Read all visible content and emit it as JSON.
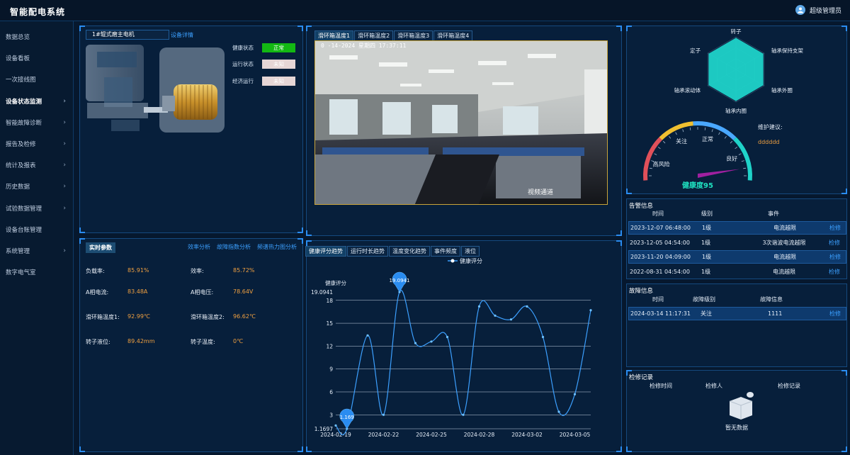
{
  "app": {
    "title": "智能配电系统",
    "user": "超级管理员"
  },
  "sidebar": [
    {
      "label": "数据总览",
      "chev": ""
    },
    {
      "label": "设备看板",
      "chev": ""
    },
    {
      "label": "一次接线图",
      "chev": ""
    },
    {
      "label": "设备状态监测",
      "chev": "›",
      "active": true
    },
    {
      "label": "智能故障诊断",
      "chev": "›"
    },
    {
      "label": "报告及检修",
      "chev": "›"
    },
    {
      "label": "统计及报表",
      "chev": "›"
    },
    {
      "label": "历史数据",
      "chev": "›"
    },
    {
      "label": "试验数据管理",
      "chev": "›"
    },
    {
      "label": "设备台账管理",
      "chev": ""
    },
    {
      "label": "系统管理",
      "chev": "›"
    },
    {
      "label": "数字电气室",
      "chev": ""
    }
  ],
  "motor": {
    "name": "1#辊式磨主电机",
    "detail_link": "设备详情",
    "health_label": "健康状态",
    "health_value": "正常",
    "run_label": "运行状态",
    "run_value": "未知",
    "econ_label": "经济运行",
    "econ_value": "未知"
  },
  "realtime": {
    "title": "实时参数",
    "links": [
      "效率分析",
      "故障指数分析",
      "频谱热力图分析"
    ],
    "params": [
      {
        "k": "负载率:",
        "v": "85.91%"
      },
      {
        "k": "效率:",
        "v": "85.72%"
      },
      {
        "k": "A相电流:",
        "v": "83.48A"
      },
      {
        "k": "A相电压:",
        "v": "78.64V"
      },
      {
        "k": "滑环箱温度1:",
        "v": "92.99℃"
      },
      {
        "k": "滑环箱温度2:",
        "v": "96.62℃"
      },
      {
        "k": "转子液位:",
        "v": "89.42mm"
      },
      {
        "k": "转子温度:",
        "v": "0℃"
      }
    ]
  },
  "video": {
    "tabs": [
      "滑环箱温度1",
      "滑环箱温度2",
      "滑环箱温度3",
      "滑环箱温度4"
    ],
    "timestamp": "0 -14-2024  星期四  17:37:11",
    "overlay": "视频通道"
  },
  "trend": {
    "tabs": [
      "健康评分趋势",
      "运行时长趋势",
      "温度变化趋势",
      "事件频度",
      "液位"
    ],
    "legend": "健康评分"
  },
  "chart_data": {
    "type": "line",
    "title": "",
    "ylabel": "健康评分",
    "ylim": [
      1.1697,
      19.0941
    ],
    "yticks": [
      "19.0941",
      "18",
      "15",
      "12",
      "9",
      "6",
      "3",
      "1.1697"
    ],
    "xticks": [
      "2024-02-19",
      "2024-02-22",
      "2024-02-25",
      "2024-02-28",
      "2024-03-02",
      "2024-03-05"
    ],
    "series": [
      {
        "name": "健康评分",
        "values": [
          {
            "x": 0,
            "y": 1.6
          },
          {
            "x": 0.7,
            "y": 1.1697
          },
          {
            "x": 2,
            "y": 13.4
          },
          {
            "x": 3,
            "y": 3
          },
          {
            "x": 4,
            "y": 19.0941
          },
          {
            "x": 5,
            "y": 12.4
          },
          {
            "x": 6,
            "y": 12.6
          },
          {
            "x": 7,
            "y": 13.2
          },
          {
            "x": 8,
            "y": 3
          },
          {
            "x": 9,
            "y": 17.2
          },
          {
            "x": 10,
            "y": 16
          },
          {
            "x": 11,
            "y": 15.5
          },
          {
            "x": 12,
            "y": 17.2
          },
          {
            "x": 13,
            "y": 13.2
          },
          {
            "x": 14,
            "y": 3.4
          },
          {
            "x": 15,
            "y": 5.7
          },
          {
            "x": 16,
            "y": 16.7
          }
        ]
      }
    ],
    "markers": [
      {
        "label": "19.0941"
      },
      {
        "label": "1.169"
      }
    ]
  },
  "radar": {
    "labels": [
      "转子",
      "轴承保持支架",
      "轴承外圈",
      "轴承内圈",
      "轴承滚动体",
      "定子"
    ]
  },
  "gauge": {
    "labels": [
      "高风险",
      "关注",
      "正常",
      "良好"
    ],
    "score_label": "健康度95",
    "advice_label": "维护建议:",
    "advice_value": "dddddd"
  },
  "alarms": {
    "title": "告警信息",
    "headers": [
      "时间",
      "级别",
      "事件"
    ],
    "rows": [
      {
        "time": "2023-12-07 06:48:00",
        "level": "1级",
        "event": "电流越限",
        "action": "检修"
      },
      {
        "time": "2023-12-05 04:54:00",
        "level": "1级",
        "event": "3次谐波电流越限",
        "action": "检修"
      },
      {
        "time": "2023-11-20 04:09:00",
        "level": "1级",
        "event": "电流越限",
        "action": "检修"
      },
      {
        "time": "2022-08-31 04:54:00",
        "level": "1级",
        "event": "电流越限",
        "action": "检修"
      }
    ]
  },
  "faults": {
    "title": "故障信息",
    "headers": [
      "时间",
      "故障级别",
      "故障信息"
    ],
    "rows": [
      {
        "time": "2024-03-14 11:17:31",
        "level": "关注",
        "info": "1111",
        "action": "检修"
      }
    ]
  },
  "maintenance": {
    "title": "检修记录",
    "headers": [
      "检修时间",
      "检修人",
      "检修记录"
    ],
    "empty": "暂无数据"
  },
  "colors": {
    "accent": "#2a8cf0",
    "ok": "#13b813",
    "warn": "#f0a040",
    "teal": "#1fd3c9"
  }
}
